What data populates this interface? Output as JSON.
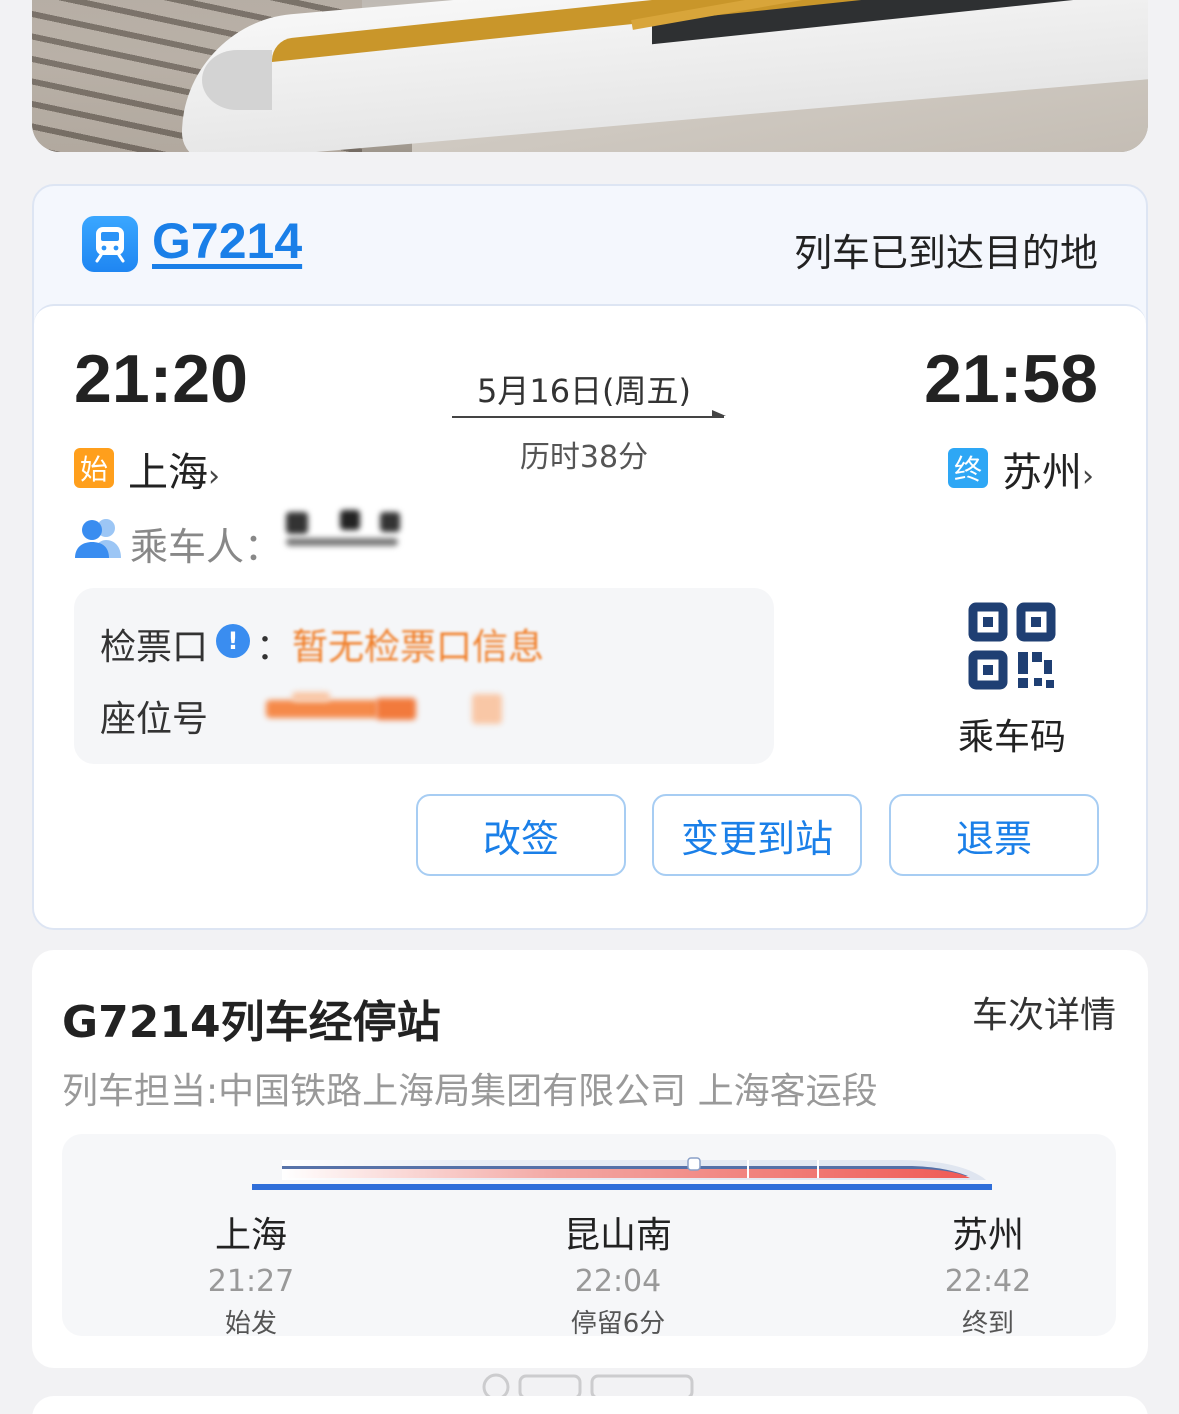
{
  "ticket": {
    "train_no": "G7214",
    "status": "列车已到达目的地",
    "departure_time": "21:20",
    "arrival_time": "21:58",
    "date": "5月16日(周五)",
    "duration": "历时38分",
    "start_tag": "始",
    "end_tag": "终",
    "from_station": "上海",
    "to_station": "苏州",
    "chevron": "›",
    "passenger_label": "乘车人：",
    "gate_label": "检票口",
    "gate_info_icon": "!",
    "gate_colon": "：",
    "gate_value": "暂无检票口信息",
    "seat_label": "座位号",
    "qr_label": "乘车码",
    "buttons": {
      "reschedule": "改签",
      "change_destination": "变更到站",
      "refund": "退票"
    }
  },
  "stops": {
    "title": "G7214列车经停站",
    "detail_link": "车次详情",
    "operator": "列车担当:中国铁路上海局集团有限公司 上海客运段",
    "list": [
      {
        "name": "上海",
        "time": "21:27",
        "note": "始发"
      },
      {
        "name": "昆山南",
        "time": "22:04",
        "note": "停留6分"
      },
      {
        "name": "苏州",
        "time": "22:42",
        "note": "终到"
      }
    ]
  },
  "icons": {
    "train_badge": "train-icon",
    "passenger": "users-icon",
    "info": "info-icon",
    "qr": "qr-code-icon"
  },
  "colors": {
    "accent_blue": "#1a7fe8",
    "start_tag": "#ff9f1c",
    "end_tag": "#2ea7f5",
    "gate_warning": "#f07f2a"
  }
}
